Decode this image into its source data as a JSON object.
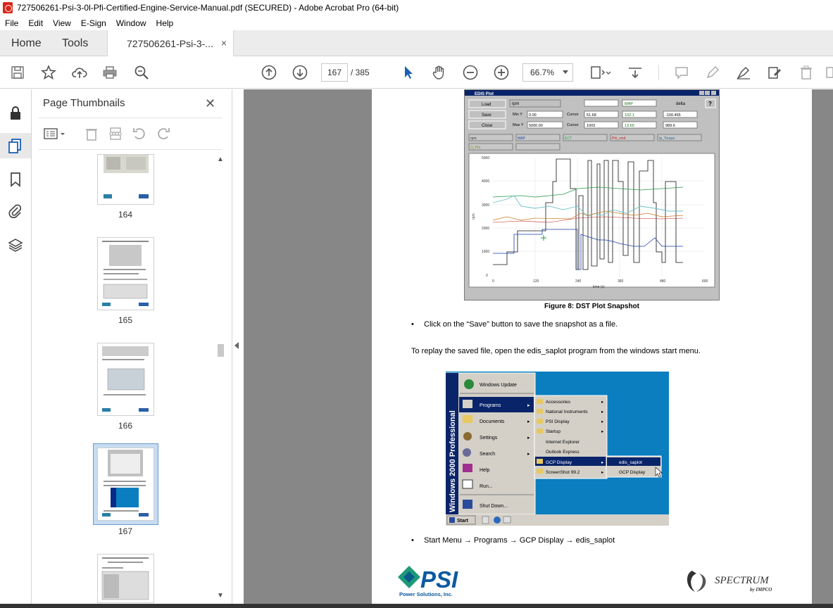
{
  "window": {
    "title": "727506261-Psi-3-0l-Pfi-Certified-Engine-Service-Manual.pdf (SECURED) - Adobe Acrobat Pro (64-bit)"
  },
  "menu": [
    "File",
    "Edit",
    "View",
    "E-Sign",
    "Window",
    "Help"
  ],
  "tabs": {
    "home": "Home",
    "tools": "Tools",
    "document": "727506261-Psi-3-...",
    "close_glyph": "×"
  },
  "toolbar": {
    "current_page": "167",
    "total_pages": "/  385",
    "zoom": "66.7%"
  },
  "thumbnails": {
    "header": "Page Thumbnails",
    "close_glyph": "✕",
    "pages": [
      {
        "number": "164",
        "selected": false
      },
      {
        "number": "165",
        "selected": false
      },
      {
        "number": "166",
        "selected": false
      },
      {
        "number": "167",
        "selected": true
      },
      {
        "number": "",
        "selected": false
      }
    ]
  },
  "plot_window": {
    "title": "EDIS Plot",
    "buttons": [
      "Load",
      "Save",
      "Close"
    ],
    "select_value": "rpm",
    "max_y_label": "Max Y",
    "min_y_label": "Min Y",
    "max_y": "5000.00",
    "min_y": "0.00",
    "cursor_label": "Cursor",
    "delta_label": "delta",
    "col1_header": "rpm",
    "col2_header": "MAP",
    "cursor1": "51.68",
    "cursor2": "1003",
    "map1": "102.1",
    "map2": "13.65",
    "delta1": "-100.465",
    "delta2": "989.6",
    "legend": [
      "rpm",
      "MAP",
      "ECT",
      "Phi_cmd",
      "Ip_Torque",
      "O_Phi"
    ],
    "y_ticks": [
      "5000",
      "4000",
      "3000",
      "2000",
      "1000",
      "0"
    ],
    "x_ticks": [
      "0",
      "120",
      "240",
      "360",
      "480",
      "600"
    ],
    "y_axis_label": "rpm",
    "x_axis_label": "time (s)"
  },
  "document": {
    "caption": "Figure 8:  DST Plot Snapshot",
    "bullet1": "Click on the “Save” button to save the snapshot as a file.",
    "paragraph": "To replay the saved file, open the edis_saplot program from the windows start menu.",
    "bullet2": "Start Menu → Programs → GCP Display → edis_saplot",
    "bullet_glyph": "•"
  },
  "start_menu": {
    "side_banner": "Windows 2000 Professional",
    "items": [
      "Windows Update",
      "Programs",
      "Documents",
      "Settings",
      "Search",
      "Help",
      "Run...",
      "Shut Down..."
    ],
    "programs_submenu": [
      "Accessories",
      "National Instruments",
      "PSI Display",
      "Startup",
      "Internet Explorer",
      "Outlook Express",
      "GCP Display",
      "ScreenShot 99.2"
    ],
    "gcp_submenu": [
      "edis_saplot",
      "GCP Display"
    ],
    "start_button": "Start"
  },
  "logos": {
    "psi_text": "PSI",
    "psi_subtitle": "Power Solutions, Inc.",
    "spectrum_text": "SPECTRUM",
    "spectrum_subtitle": "by IMPCO"
  },
  "colors": {
    "accent_blue": "#0a7ebf",
    "doc_background": "#878787",
    "selection": "#c7dcf2"
  }
}
